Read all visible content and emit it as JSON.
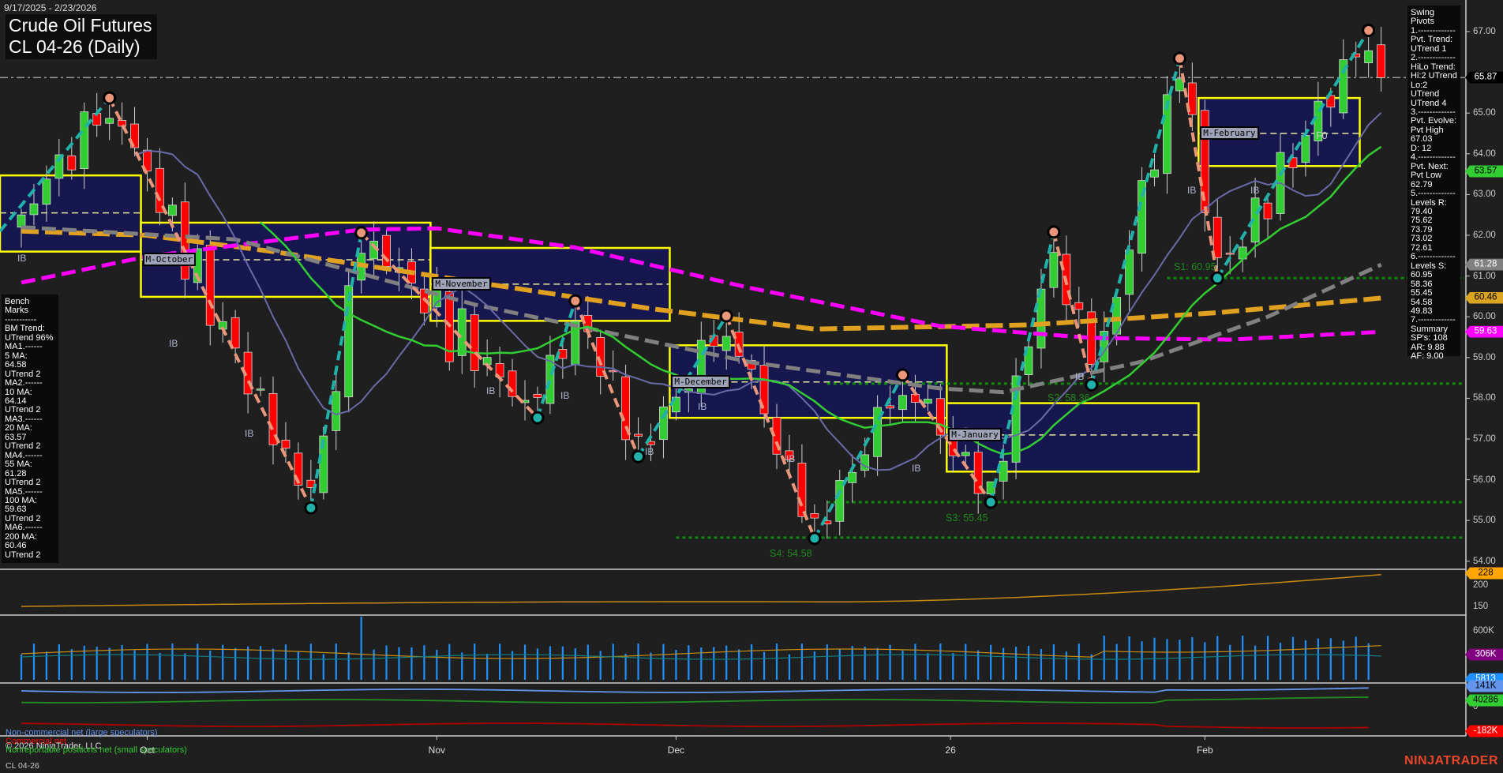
{
  "header": {
    "date_range": "9/17/2025 - 2/23/2026",
    "title": "Crude Oil Futures",
    "subtitle": "CL 04-26 (Daily)"
  },
  "bench_marks": [
    "Bench Marks",
    "-----------",
    "BM Trend:",
    "UTrend 96%",
    "MA1.------",
    "5 MA:",
    "64.58",
    "UTrend 2",
    "MA2.------",
    "10 MA:",
    "64.14",
    "UTrend 2",
    "MA3.------",
    "20 MA:",
    "63.57",
    "UTrend 2",
    "MA4.------",
    "55 MA:",
    "61.28",
    "UTrend 2",
    "MA5.------",
    "100 MA:",
    "59.63",
    "UTrend 2",
    "MA6.------",
    "200 MA:",
    "60.46",
    "UTrend 2"
  ],
  "swing_pivots": [
    "Swing Pivots",
    "1.-------------",
    "Pvt. Trend:",
    "UTrend 1",
    "2.-------------",
    "HiLo Trend:",
    "Hi:2 UTrend",
    "Lo:2 UTrend",
    "UTrend 4",
    "3.-------------",
    "Pvt. Evolve:",
    "Pvt High",
    "67.03",
    "D: 12",
    "4.-------------",
    "Pvt. Next:",
    "Pvt Low",
    "62.79",
    "5.-------------",
    "Levels R:",
    "79.40",
    "75.62",
    "73.79",
    "73.02",
    "72.61",
    "6.-------------",
    "Levels S:",
    "60.95",
    "58.36",
    "55.45",
    "54.58",
    "49.83",
    "7.-------------",
    "Summary",
    "SP's: 108",
    "AR: 9.88",
    "AF: 9.00"
  ],
  "legend": {
    "noncommercial": "Non-commercial net (large speculators)",
    "commercial": "Commercial net",
    "nonreportable": "Nonreportable positions net (small speculators)",
    "copyright": "© 2026 NinjaTrader, LLC"
  },
  "footer": {
    "instrument": "CL 04-26",
    "logo": "NINJATRADER"
  },
  "x_axis": [
    {
      "label": "Oct",
      "bar": 10
    },
    {
      "label": "Nov",
      "bar": 33
    },
    {
      "label": "Dec",
      "bar": 52
    },
    {
      "label": "26",
      "bar": 73.8
    },
    {
      "label": "Feb",
      "bar": 94
    }
  ],
  "monthly_labels": {
    "sep": "",
    "oct": "M-October",
    "nov": "M-November",
    "dec": "M-December",
    "jan": "M-January",
    "feb": "M-February",
    "f0": "F0"
  },
  "support_labels": [
    "S1: 60.95",
    "S2: 58.36",
    "S3: 55.45",
    "S4: 54.58"
  ],
  "ib_label": "IB",
  "colors": {
    "up": "#32cd32",
    "down": "#ff0000",
    "zig_up": "#20b2aa",
    "zig_down": "#e9967a",
    "ma200": "#e0a020",
    "ma100": "#ff00ff",
    "ma55": "#808080",
    "ma20": "#32cd32",
    "ma10": "#6a6aa8",
    "box_fill": "#171750",
    "box_edge": "#ffff00"
  },
  "price_axis": {
    "ticks": [
      "67.00",
      "65.00",
      "64.00",
      "63.00",
      "62.00",
      "61.00",
      "60.00",
      "59.00",
      "58.00",
      "57.00",
      "56.00",
      "55.00",
      "54.00"
    ],
    "tags": [
      {
        "value": "65.87",
        "bg": "#000000",
        "fg": "#ffffff"
      },
      {
        "value": "63.57",
        "bg": "#32cd32",
        "fg": "#000000"
      },
      {
        "value": "61.28",
        "bg": "#808080",
        "fg": "#ffffff"
      },
      {
        "value": "60.46",
        "bg": "#daa520",
        "fg": "#000000"
      },
      {
        "value": "59.63",
        "bg": "#ff00ff",
        "fg": "#ffffff"
      }
    ]
  },
  "lower_axes": {
    "p2": {
      "ticks": [
        "200",
        "150"
      ],
      "tag": {
        "value": "228",
        "bg": "#ffa500",
        "fg": "#000"
      }
    },
    "p3": {
      "ticks": [
        "600K"
      ],
      "tags": [
        {
          "value": "306K",
          "bg": "#800080",
          "fg": "#fff"
        },
        {
          "value": "5813",
          "bg": "#1e90ff",
          "fg": "#fff"
        }
      ]
    },
    "p4": {
      "ticks": [
        "0"
      ],
      "tags": [
        {
          "value": "141K",
          "bg": "#6495ed",
          "fg": "#000"
        },
        {
          "value": "40286",
          "bg": "#32cd32",
          "fg": "#000"
        },
        {
          "value": "-182K",
          "bg": "#ff0000",
          "fg": "#fff"
        }
      ]
    }
  },
  "chart_data": {
    "type": "candlestick",
    "title": "Crude Oil Futures CL 04-26 (Daily)",
    "bars": 109,
    "ylim": [
      53.7,
      67.6
    ],
    "last_price": 65.87,
    "pivots": [
      {
        "bar": 0,
        "price": 62.5,
        "type": "start"
      },
      {
        "bar": 7,
        "price": 65.37,
        "type": "high"
      },
      {
        "bar": 23,
        "price": 55.31,
        "type": "low"
      },
      {
        "bar": 27,
        "price": 62.06,
        "type": "high"
      },
      {
        "bar": 41,
        "price": 57.52,
        "type": "low"
      },
      {
        "bar": 44,
        "price": 60.39,
        "type": "high"
      },
      {
        "bar": 49,
        "price": 56.57,
        "type": "low"
      },
      {
        "bar": 56,
        "price": 60.02,
        "type": "high"
      },
      {
        "bar": 63,
        "price": 54.56,
        "type": "low"
      },
      {
        "bar": 70,
        "price": 58.57,
        "type": "high"
      },
      {
        "bar": 77,
        "price": 55.45,
        "type": "low"
      },
      {
        "bar": 82,
        "price": 62.08,
        "type": "high"
      },
      {
        "bar": 85,
        "price": 58.33,
        "type": "low"
      },
      {
        "bar": 92,
        "price": 66.34,
        "type": "high"
      },
      {
        "bar": 95,
        "price": 60.95,
        "type": "low"
      },
      {
        "bar": 107,
        "price": 67.03,
        "type": "high"
      },
      {
        "bar": 108,
        "price": 65.87,
        "type": "end"
      }
    ],
    "ma200": [
      [
        0,
        62.1
      ],
      [
        10,
        62.0
      ],
      [
        20,
        61.6
      ],
      [
        36,
        60.85
      ],
      [
        50,
        60.2
      ],
      [
        63,
        59.7
      ],
      [
        80,
        59.8
      ],
      [
        95,
        60.1
      ],
      [
        108,
        60.46
      ]
    ],
    "ma100": [
      [
        0,
        60.84
      ],
      [
        10,
        61.48
      ],
      [
        27,
        62.14
      ],
      [
        33,
        62.17
      ],
      [
        44,
        61.7
      ],
      [
        58,
        60.7
      ],
      [
        73,
        59.77
      ],
      [
        85,
        59.48
      ],
      [
        96,
        59.44
      ],
      [
        108,
        59.63
      ]
    ],
    "ma55": [
      [
        0,
        62.2
      ],
      [
        17,
        61.9
      ],
      [
        36,
        60.3
      ],
      [
        58,
        58.88
      ],
      [
        73,
        58.24
      ],
      [
        78,
        58.15
      ],
      [
        89,
        58.9
      ],
      [
        99,
        60.0
      ],
      [
        108,
        61.28
      ]
    ],
    "monthly_boxes": [
      {
        "key": "sep",
        "from": -2,
        "to": 9,
        "hi": 63.47,
        "lo": 61.6,
        "mid": 62.55
      },
      {
        "key": "oct",
        "from": 10,
        "to": 32,
        "hi": 62.31,
        "lo": 60.49,
        "mid": 61.4
      },
      {
        "key": "nov",
        "from": 33,
        "to": 51,
        "hi": 61.69,
        "lo": 59.9,
        "mid": 60.8
      },
      {
        "key": "dec",
        "from": 52,
        "to": 73,
        "hi": 59.3,
        "lo": 57.52,
        "mid": 58.4
      },
      {
        "key": "jan",
        "from": 74,
        "to": 93,
        "hi": 57.88,
        "lo": 56.2,
        "mid": 57.1
      },
      {
        "key": "feb",
        "from": 94,
        "to": 105.8,
        "hi": 65.37,
        "lo": 63.7,
        "mid": 64.5
      }
    ],
    "supports": [
      {
        "price": 60.95,
        "from": 91
      },
      {
        "price": 58.36,
        "from": 64
      },
      {
        "price": 55.45,
        "from": 64
      },
      {
        "price": 54.58,
        "from": 52
      }
    ]
  }
}
